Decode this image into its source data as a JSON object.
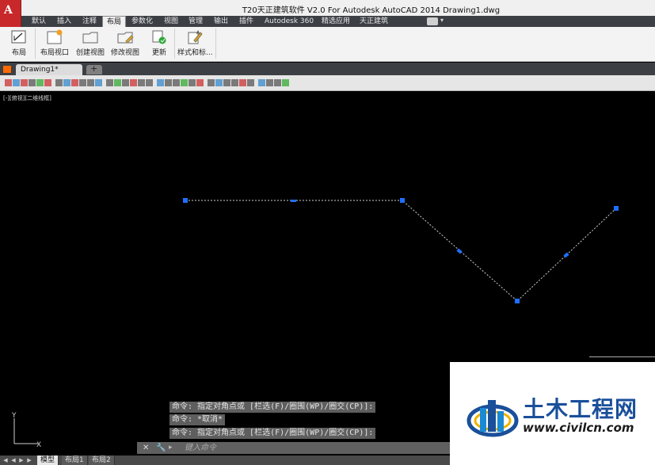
{
  "titlebar": {
    "app_logo_letter": "A",
    "title": "T20天正建筑软件 V2.0 For Autodesk AutoCAD 2014    Drawing1.dwg"
  },
  "menu_tabs": [
    {
      "label": "默认"
    },
    {
      "label": "插入"
    },
    {
      "label": "注释"
    },
    {
      "label": "布局"
    },
    {
      "label": "参数化"
    },
    {
      "label": "视图"
    },
    {
      "label": "管理"
    },
    {
      "label": "输出"
    },
    {
      "label": "插件"
    },
    {
      "label": "Autodesk 360"
    },
    {
      "label": "精选应用"
    },
    {
      "label": "天正建筑"
    }
  ],
  "active_tab": "布局",
  "ribbon": {
    "buttons": [
      {
        "label": "布局",
        "icon": "layout-icon"
      },
      {
        "label": "布局视口",
        "icon": "layout-viewport-icon"
      },
      {
        "label": "创建视图",
        "icon": "create-view-icon"
      },
      {
        "label": "修改视图",
        "icon": "modify-view-icon"
      },
      {
        "label": "更新",
        "icon": "update-icon"
      },
      {
        "label": "样式和标...",
        "icon": "styles-standards-icon"
      }
    ]
  },
  "document": {
    "tab_label": "Drawing1*",
    "new_tab_symbol": "+"
  },
  "viewport": {
    "label": "[-][俯视][二维线框]"
  },
  "command": {
    "history": [
      "命令: 指定对角点或 [栏选(F)/圈围(WP)/圈交(CP)]:",
      "命令: *取消*",
      "命令: 指定对角点或 [栏选(F)/圈围(WP)/圈交(CP)]:"
    ],
    "close_symbol": "✕",
    "wrench_symbol": "🔧",
    "prompt_symbol": "▸",
    "input_placeholder": "键入命令"
  },
  "ucs": {
    "y_label": "Y",
    "x_label": "X"
  },
  "layout_tabs": [
    {
      "label": "模型",
      "active": true
    },
    {
      "label": "布局1",
      "active": false
    },
    {
      "label": "布局2",
      "active": false
    }
  ],
  "watermark": {
    "title": "土木工程网",
    "url": "www.civilcn.com"
  },
  "colors": {
    "accent": "#c8282a",
    "grip": "#1e6fff",
    "dark_ui": "#3c3f44"
  }
}
